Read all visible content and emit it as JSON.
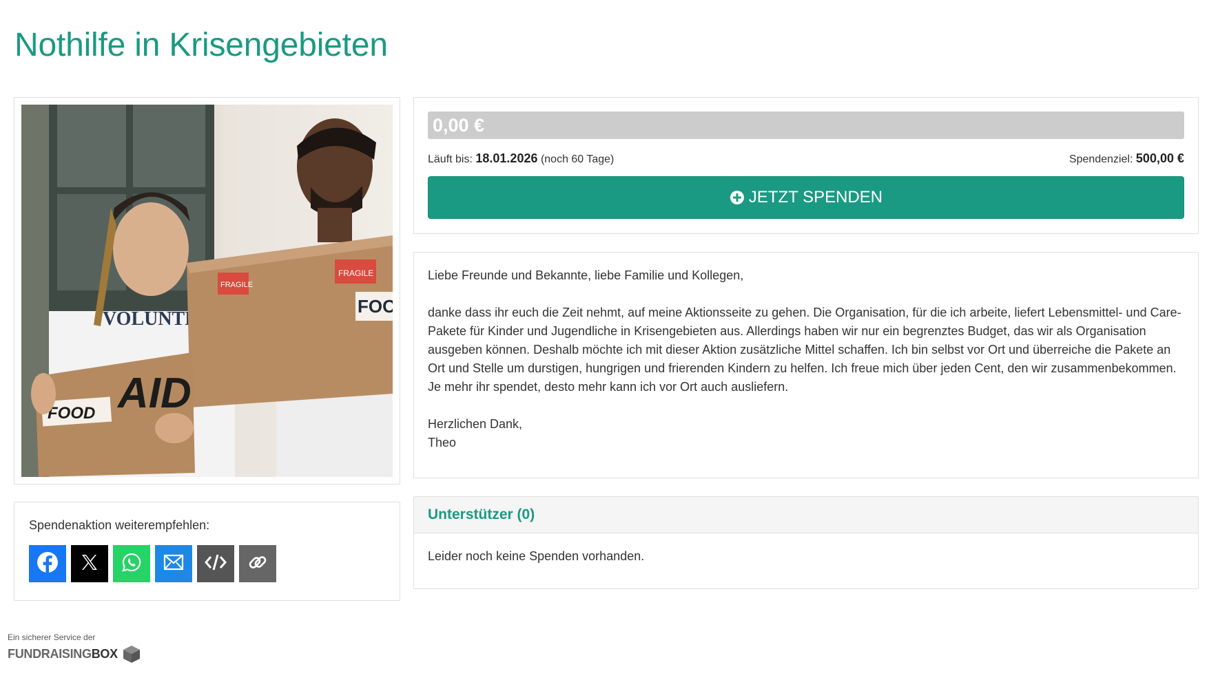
{
  "page": {
    "title": "Nothilfe in Krisengebieten"
  },
  "hero_image": {
    "alt": "",
    "texts": {
      "shirt": "VOLUNTEER",
      "box_big": "AID",
      "box_small": "FOOD",
      "box_right": "FOO",
      "sticker": "FRAGILE"
    }
  },
  "progress": {
    "amount": "0,00 €",
    "fraction": 0,
    "runs_until_label": "Läuft bis:",
    "end_date": "18.01.2026",
    "remaining": "(noch 60 Tage)",
    "goal_label": "Spendenziel:",
    "goal_amount": "500,00 €",
    "donate_button": "JETZT SPENDEN"
  },
  "description": {
    "greeting": "Liebe Freunde und Bekannte, liebe Familie und Kollegen,",
    "body": "danke dass ihr euch die Zeit nehmt, auf meine Aktionsseite zu gehen. Die Organisation, für die ich arbeite, liefert Lebensmittel- und Care-Pakete für Kinder und Jugendliche in Krisengebieten aus. Allerdings haben wir nur ein begrenztes Budget, das wir als Organisation ausgeben können. Deshalb möchte ich mit dieser Aktion zusätzliche Mittel schaffen. Ich bin selbst vor Ort und überreiche die Pakete an Ort und Stelle um durstigen, hungrigen und frierenden Kindern zu helfen. Ich freue mich über jeden Cent, den wir zusammenbekommen. Je mehr ihr spendet, desto mehr kann ich vor Ort auch ausliefern.",
    "closing": "Herzlichen Dank,",
    "signature": "Theo"
  },
  "share": {
    "label": "Spendenaktion weiterempfehlen:",
    "buttons": [
      {
        "name": "facebook",
        "icon": "facebook-icon",
        "color": "#1877f2"
      },
      {
        "name": "x",
        "icon": "x-icon",
        "color": "#000000"
      },
      {
        "name": "whatsapp",
        "icon": "whatsapp-icon",
        "color": "#25d366"
      },
      {
        "name": "email",
        "icon": "mail-icon",
        "color": "#1e88e5"
      },
      {
        "name": "embed",
        "icon": "code-icon",
        "color": "#555555"
      },
      {
        "name": "link",
        "icon": "link-icon",
        "color": "#666666"
      }
    ]
  },
  "supporters": {
    "title": "Unterstützer (0)",
    "empty": "Leider noch keine Spenden vorhanden."
  },
  "footer": {
    "service": "Ein sicherer Service der",
    "brand_a": "FUNDRAISING",
    "brand_b": "BOX"
  },
  "colors": {
    "accent": "#1a9a82",
    "progress_track": "#cccccc"
  }
}
